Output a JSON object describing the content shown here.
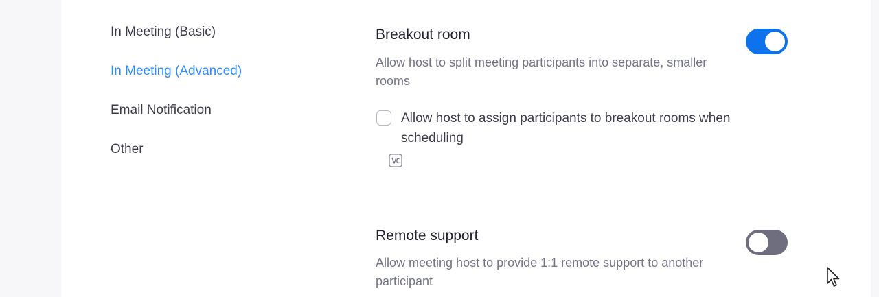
{
  "sidebar": {
    "items": [
      {
        "label": "In Meeting (Basic)",
        "active": false
      },
      {
        "label": "In Meeting (Advanced)",
        "active": true
      },
      {
        "label": "Email Notification",
        "active": false
      },
      {
        "label": "Other",
        "active": false
      }
    ]
  },
  "settings": {
    "breakout_room": {
      "title": "Breakout room",
      "description": "Allow host to split meeting participants into separate, smaller rooms",
      "enabled": true,
      "option": {
        "label": "Allow host to assign participants to breakout rooms when scheduling",
        "checked": false
      },
      "icon": "video-badge-icon"
    },
    "remote_support": {
      "title": "Remote support",
      "description": "Allow meeting host to provide 1:1 remote support to another participant",
      "enabled": false
    }
  },
  "colors": {
    "accent": "#2d8cff",
    "toggle_on": "#0e72ed",
    "toggle_off": "#6e6e7e",
    "text_primary": "#23232f",
    "text_secondary": "#747487"
  }
}
